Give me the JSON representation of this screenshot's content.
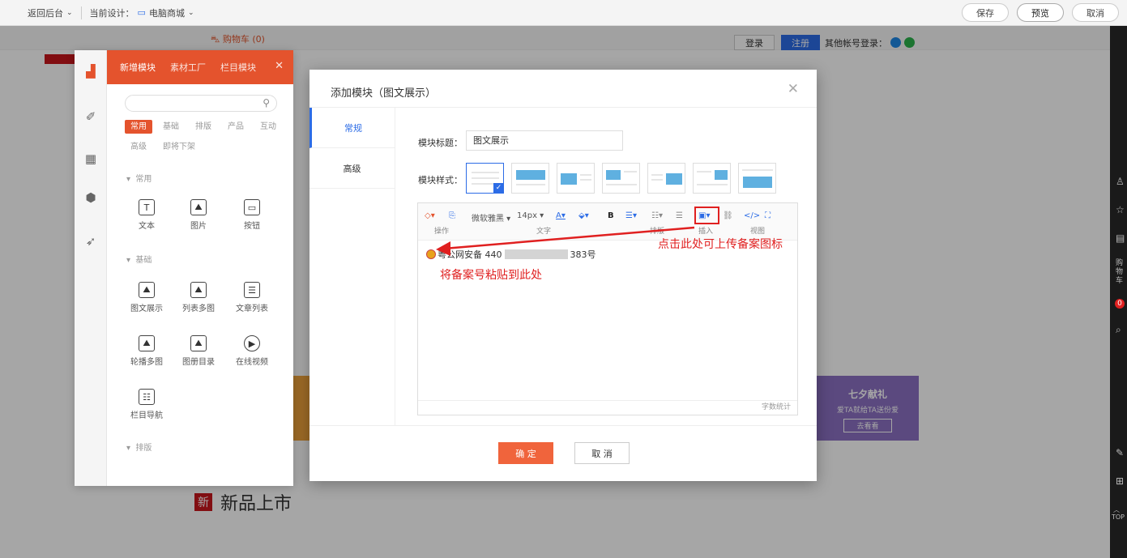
{
  "topbar": {
    "back": "返回后台",
    "design_label": "当前设计：",
    "design_value": "电脑商城",
    "save": "保存",
    "preview": "预览",
    "cancel": "取消"
  },
  "site": {
    "cart": "购物车 (0)",
    "login": "登录",
    "register": "注册",
    "other_login": "其他帐号登录：",
    "new_title": "新品上市",
    "banner_title": "七夕献礼",
    "banner_sub": "爱TA就给TA送份爱",
    "banner_btn": "去看看"
  },
  "rightbar": {
    "cart_text": "购物车",
    "cart_count": "0",
    "top": "TOP"
  },
  "sidepanel": {
    "tabs": [
      "新增模块",
      "素材工厂",
      "栏目模块"
    ],
    "tags": [
      {
        "label": "常用",
        "on": true
      },
      {
        "label": "基础",
        "on": false
      },
      {
        "label": "排版",
        "on": false
      },
      {
        "label": "产品",
        "on": false
      },
      {
        "label": "互动",
        "on": false
      },
      {
        "label": "高级",
        "on": false
      },
      {
        "label": "即将下架",
        "on": false
      }
    ],
    "sections": [
      "常用",
      "基础",
      "排版"
    ],
    "modules": {
      "text": "文本",
      "image": "图片",
      "button": "按钮",
      "image_text": "图文展示",
      "list_images": "列表多图",
      "article_list": "文章列表",
      "carousel": "轮播多图",
      "album": "图册目录",
      "video": "在线视频",
      "nav": "栏目导航"
    }
  },
  "modal": {
    "title": "添加模块（图文展示）",
    "tabs": [
      "常规",
      "高级"
    ],
    "field_title_label": "模块标题：",
    "field_title_value": "图文展示",
    "field_style_label": "模块样式：",
    "toolbar": {
      "font": "微软雅黑",
      "size": "14px",
      "bold": "B",
      "g_ops": "操作",
      "g_text": "文字",
      "g_layout": "排版",
      "g_insert": "插入",
      "g_view": "视图"
    },
    "content_prefix": "粤公网安备 440",
    "content_suffix": "383号",
    "word_count": "字数统计",
    "ok": "确 定",
    "cancel": "取 消"
  },
  "annotations": {
    "upload_tip": "点击此处可上传备案图标",
    "paste_tip": "将备案号粘贴到此处"
  },
  "colors": {
    "accent": "#e4532d",
    "primary_blue": "#2c6ce6",
    "annotation_red": "#e02020"
  }
}
